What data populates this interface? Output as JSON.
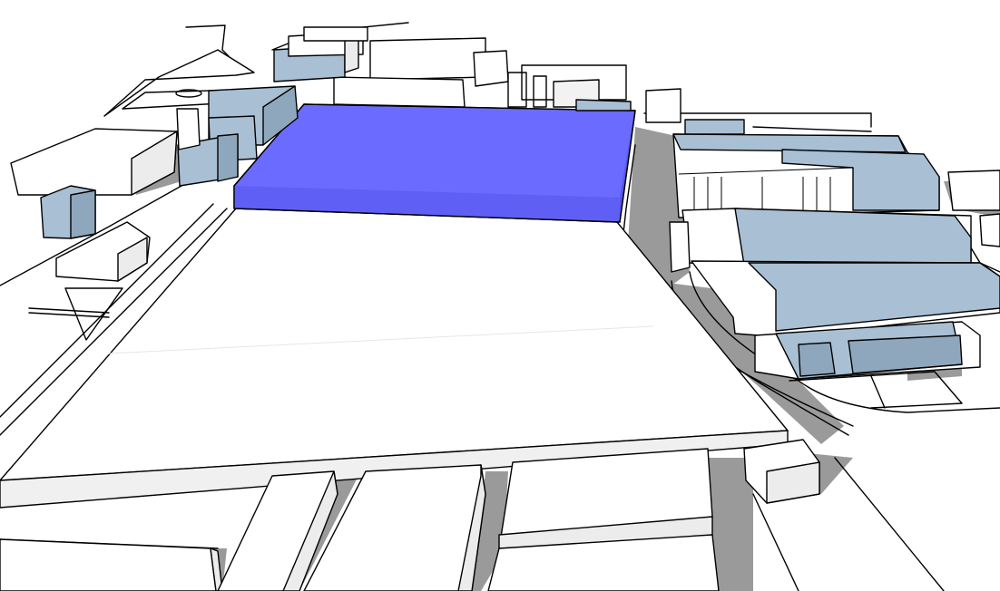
{
  "colors": {
    "background": "#ffffff",
    "highlighted_block": "#6b6bff",
    "highlighted_block_side": "#5b5bef",
    "blue_building_roof": "#a8bfd4",
    "blue_building_side": "#8fa7bc",
    "white_building_roof": "#ffffff",
    "white_building_side": "#ececec",
    "shadow": "#9a9a9a",
    "outline": "#000000"
  },
  "scene": {
    "type": "3d-massing-model",
    "view": "aerial-perspective",
    "highlighted_element": "proposed-block"
  }
}
